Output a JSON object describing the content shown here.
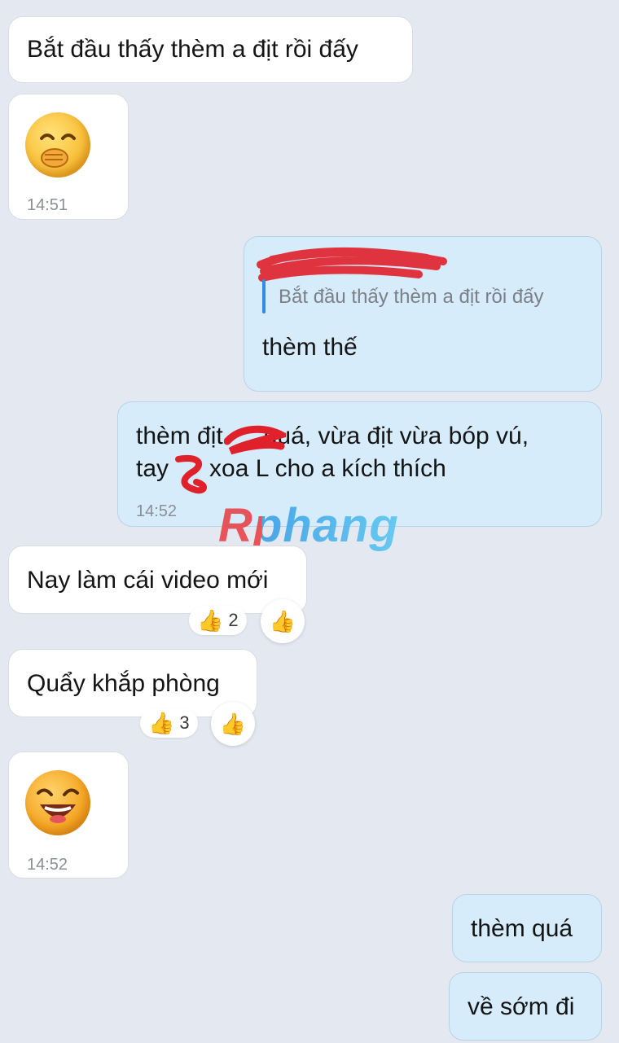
{
  "messages": [
    {
      "id": "m1",
      "text": "Bắt đầu thấy thèm a địt rồi đấy"
    },
    {
      "id": "m2",
      "emoji": "hand-over-mouth-emoji",
      "time": "14:51"
    },
    {
      "id": "m3",
      "quote": "Bắt đầu thấy thèm a địt rồi đấy",
      "text": "thèm thế"
    },
    {
      "id": "m4",
      "line1": "thèm địt      quá, vừa địt vừa bóp vú,",
      "line2": "tay      xoa L cho a kích thích",
      "time": "14:52"
    },
    {
      "id": "m5",
      "text": "Nay làm cái video mới",
      "reaction_count": "2"
    },
    {
      "id": "m6",
      "text": "Quẩy khắp phòng",
      "reaction_count": "3"
    },
    {
      "id": "m7",
      "emoji": "laughing-emoji",
      "time": "14:52"
    },
    {
      "id": "m8",
      "text": "thèm quá"
    },
    {
      "id": "m9",
      "text": "về sớm đi"
    }
  ],
  "watermark": "Rphang",
  "colors": {
    "background": "#e4e8f0",
    "incoming_bubble": "#ffffff",
    "outgoing_bubble": "#d6ecfb",
    "quote_bar": "#2f8de4",
    "redaction": "#e0202a"
  }
}
